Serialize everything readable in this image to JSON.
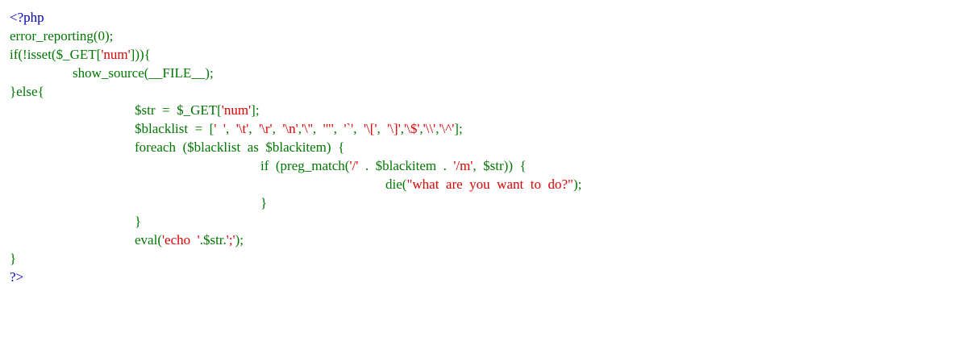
{
  "colors": {
    "default": "#000000",
    "keyword": "#007700",
    "string": "#dd0000",
    "php_tag": "#0000bb"
  },
  "lines": [
    {
      "indent": 0,
      "tokens": [
        {
          "t": "<?php",
          "c": "php_tag"
        }
      ]
    },
    {
      "indent": 0,
      "tokens": [
        {
          "t": "error_reporting(0);",
          "c": "keyword"
        }
      ]
    },
    {
      "indent": 0,
      "tokens": [
        {
          "t": "if(!isset($_GET[",
          "c": "keyword"
        },
        {
          "t": "'num'",
          "c": "string"
        },
        {
          "t": "])){",
          "c": "keyword"
        }
      ]
    },
    {
      "indent": 1,
      "tokens": [
        {
          "t": "show_source(__FILE__);",
          "c": "keyword"
        }
      ]
    },
    {
      "indent": 0,
      "tokens": [
        {
          "t": "}else{",
          "c": "keyword"
        }
      ]
    },
    {
      "indent": 2,
      "tokens": [
        {
          "t": "$str  =  $_GET[",
          "c": "keyword"
        },
        {
          "t": "'num'",
          "c": "string"
        },
        {
          "t": "];",
          "c": "keyword"
        }
      ]
    },
    {
      "indent": 2,
      "tokens": [
        {
          "t": "$blacklist  =  [",
          "c": "keyword"
        },
        {
          "t": "'  '",
          "c": "string"
        },
        {
          "t": ",  ",
          "c": "keyword"
        },
        {
          "t": "'\\t'",
          "c": "string"
        },
        {
          "t": ",  ",
          "c": "keyword"
        },
        {
          "t": "'\\r'",
          "c": "string"
        },
        {
          "t": ",  ",
          "c": "keyword"
        },
        {
          "t": "'\\n'",
          "c": "string"
        },
        {
          "t": ",",
          "c": "keyword"
        },
        {
          "t": "'\\''",
          "c": "string"
        },
        {
          "t": ",  ",
          "c": "keyword"
        },
        {
          "t": "'\"'",
          "c": "string"
        },
        {
          "t": ",  ",
          "c": "keyword"
        },
        {
          "t": "'`'",
          "c": "string"
        },
        {
          "t": ",  ",
          "c": "keyword"
        },
        {
          "t": "'\\['",
          "c": "string"
        },
        {
          "t": ",  ",
          "c": "keyword"
        },
        {
          "t": "'\\]'",
          "c": "string"
        },
        {
          "t": ",",
          "c": "keyword"
        },
        {
          "t": "'\\$'",
          "c": "string"
        },
        {
          "t": ",",
          "c": "keyword"
        },
        {
          "t": "'\\\\'",
          "c": "string"
        },
        {
          "t": ",",
          "c": "keyword"
        },
        {
          "t": "'\\^'",
          "c": "string"
        },
        {
          "t": "];",
          "c": "keyword"
        }
      ]
    },
    {
      "indent": 2,
      "tokens": [
        {
          "t": "foreach  ($blacklist  as  $blackitem)  {",
          "c": "keyword"
        }
      ]
    },
    {
      "indent": 3,
      "tokens": [
        {
          "t": "if  (preg_match(",
          "c": "keyword"
        },
        {
          "t": "'/'",
          "c": "string"
        },
        {
          "t": "  .  $blackitem  .  ",
          "c": "keyword"
        },
        {
          "t": "'/m'",
          "c": "string"
        },
        {
          "t": ",  $str))  {",
          "c": "keyword"
        }
      ]
    },
    {
      "indent": 4,
      "tokens": [
        {
          "t": "die(",
          "c": "keyword"
        },
        {
          "t": "\"what  are  you  want  to  do?\"",
          "c": "string"
        },
        {
          "t": ");",
          "c": "keyword"
        }
      ]
    },
    {
      "indent": 3,
      "tokens": [
        {
          "t": "}",
          "c": "keyword"
        }
      ]
    },
    {
      "indent": 2,
      "tokens": [
        {
          "t": "}",
          "c": "keyword"
        }
      ]
    },
    {
      "indent": 2,
      "tokens": [
        {
          "t": "eval(",
          "c": "keyword"
        },
        {
          "t": "'echo  '",
          "c": "string"
        },
        {
          "t": ".$str.",
          "c": "keyword"
        },
        {
          "t": "';'",
          "c": "string"
        },
        {
          "t": ");",
          "c": "keyword"
        }
      ]
    },
    {
      "indent": 0,
      "tokens": [
        {
          "t": "}",
          "c": "keyword"
        }
      ]
    },
    {
      "indent": 0,
      "tokens": [
        {
          "t": "?>",
          "c": "php_tag"
        }
      ]
    }
  ]
}
